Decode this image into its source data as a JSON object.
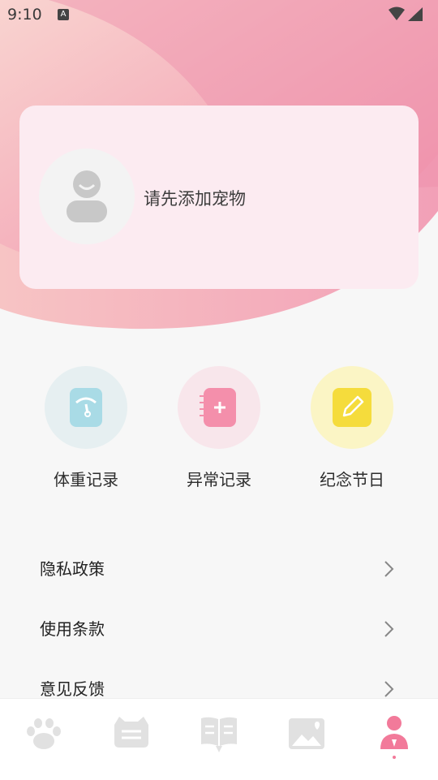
{
  "status_bar": {
    "time": "9:10",
    "badge": "A"
  },
  "pet_card": {
    "prompt": "请先添加宠物"
  },
  "shortcuts": [
    {
      "label": "体重记录",
      "icon": "scale-icon",
      "color": "#a9dbe6"
    },
    {
      "label": "异常记录",
      "icon": "notebook-plus-icon",
      "color": "#f48fab"
    },
    {
      "label": "纪念节日",
      "icon": "pencil-note-icon",
      "color": "#f5dc3c"
    }
  ],
  "menu": [
    {
      "label": "隐私政策"
    },
    {
      "label": "使用条款"
    },
    {
      "label": "意见反馈"
    }
  ],
  "tabbar": {
    "tabs": [
      "paw-icon",
      "cat-face-icon",
      "book-chat-icon",
      "gallery-icon",
      "profile-icon"
    ],
    "active": "profile-icon",
    "active_color": "#f27a9a",
    "inactive_color": "#e1e1e1"
  }
}
